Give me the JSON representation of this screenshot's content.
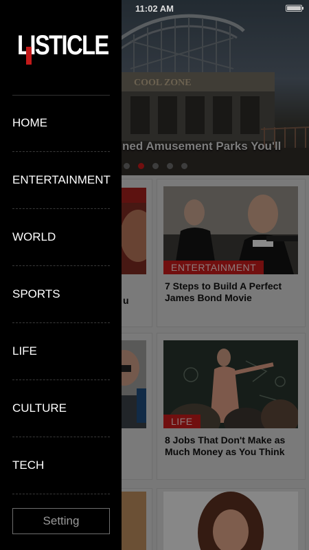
{
  "status_bar": {
    "time": "11:02 AM"
  },
  "brand": {
    "logo_text": "LISTICLE"
  },
  "drawer": {
    "nav_items": [
      "HOME",
      "ENTERTAINMENT",
      "WORLD",
      "SPORTS",
      "LIFE",
      "CULTURE",
      "TECH"
    ],
    "setting_label": "Setting"
  },
  "hero": {
    "title": "ned Amusement Parks You'll",
    "sign_text": "COOL ZONE",
    "pager": {
      "count": 5,
      "active_index": 1
    }
  },
  "feed": {
    "left_column": {
      "snippet": "u"
    },
    "cards": [
      {
        "tag": "ENTERTAINMENT",
        "title": "7 Steps to Build A Perfect James Bond Movie"
      },
      {
        "tag": "LIFE",
        "title": "8 Jobs That Don't Make as Much Money as You Think"
      }
    ]
  },
  "colors": {
    "accent": "#c31a1a",
    "drawer_bg": "#000000",
    "feed_bg": "#cfcfcf"
  }
}
